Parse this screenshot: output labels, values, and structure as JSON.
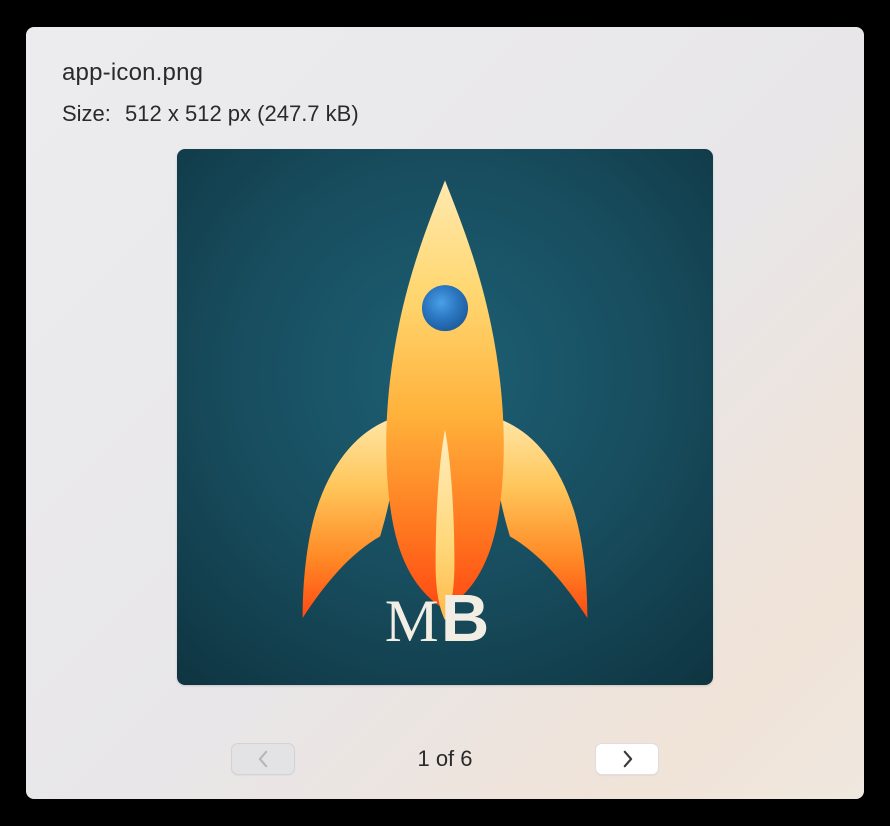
{
  "file": {
    "name": "app-icon.png",
    "size_label": "Size:",
    "dimensions": "512 x 512 px",
    "filesize": "(247.7 kB)"
  },
  "pager": {
    "current": 1,
    "total": 6,
    "indicator": "1 of 6"
  },
  "icon": {
    "badge_text_thin": "M",
    "badge_text_bold": "B"
  }
}
